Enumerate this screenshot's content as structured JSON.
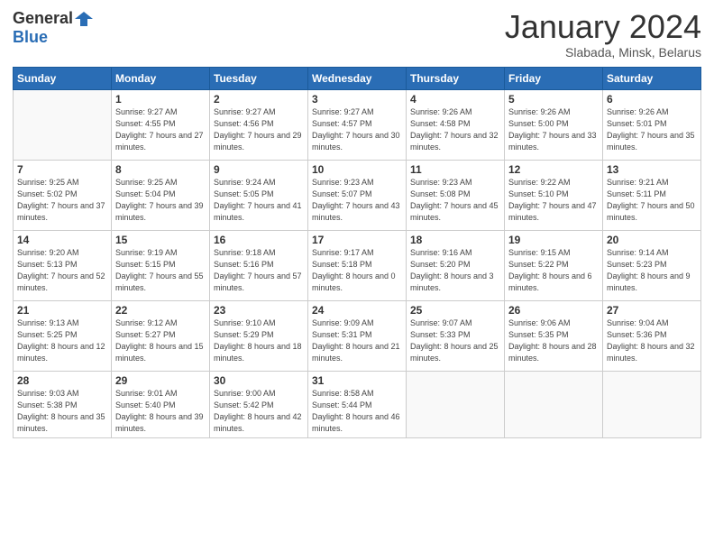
{
  "logo": {
    "general": "General",
    "blue": "Blue"
  },
  "header": {
    "title": "January 2024",
    "subtitle": "Slabada, Minsk, Belarus"
  },
  "weekdays": [
    "Sunday",
    "Monday",
    "Tuesday",
    "Wednesday",
    "Thursday",
    "Friday",
    "Saturday"
  ],
  "weeks": [
    [
      {
        "day": "",
        "sunrise": "",
        "sunset": "",
        "daylight": ""
      },
      {
        "day": "1",
        "sunrise": "Sunrise: 9:27 AM",
        "sunset": "Sunset: 4:55 PM",
        "daylight": "Daylight: 7 hours and 27 minutes."
      },
      {
        "day": "2",
        "sunrise": "Sunrise: 9:27 AM",
        "sunset": "Sunset: 4:56 PM",
        "daylight": "Daylight: 7 hours and 29 minutes."
      },
      {
        "day": "3",
        "sunrise": "Sunrise: 9:27 AM",
        "sunset": "Sunset: 4:57 PM",
        "daylight": "Daylight: 7 hours and 30 minutes."
      },
      {
        "day": "4",
        "sunrise": "Sunrise: 9:26 AM",
        "sunset": "Sunset: 4:58 PM",
        "daylight": "Daylight: 7 hours and 32 minutes."
      },
      {
        "day": "5",
        "sunrise": "Sunrise: 9:26 AM",
        "sunset": "Sunset: 5:00 PM",
        "daylight": "Daylight: 7 hours and 33 minutes."
      },
      {
        "day": "6",
        "sunrise": "Sunrise: 9:26 AM",
        "sunset": "Sunset: 5:01 PM",
        "daylight": "Daylight: 7 hours and 35 minutes."
      }
    ],
    [
      {
        "day": "7",
        "sunrise": "Sunrise: 9:25 AM",
        "sunset": "Sunset: 5:02 PM",
        "daylight": "Daylight: 7 hours and 37 minutes."
      },
      {
        "day": "8",
        "sunrise": "Sunrise: 9:25 AM",
        "sunset": "Sunset: 5:04 PM",
        "daylight": "Daylight: 7 hours and 39 minutes."
      },
      {
        "day": "9",
        "sunrise": "Sunrise: 9:24 AM",
        "sunset": "Sunset: 5:05 PM",
        "daylight": "Daylight: 7 hours and 41 minutes."
      },
      {
        "day": "10",
        "sunrise": "Sunrise: 9:23 AM",
        "sunset": "Sunset: 5:07 PM",
        "daylight": "Daylight: 7 hours and 43 minutes."
      },
      {
        "day": "11",
        "sunrise": "Sunrise: 9:23 AM",
        "sunset": "Sunset: 5:08 PM",
        "daylight": "Daylight: 7 hours and 45 minutes."
      },
      {
        "day": "12",
        "sunrise": "Sunrise: 9:22 AM",
        "sunset": "Sunset: 5:10 PM",
        "daylight": "Daylight: 7 hours and 47 minutes."
      },
      {
        "day": "13",
        "sunrise": "Sunrise: 9:21 AM",
        "sunset": "Sunset: 5:11 PM",
        "daylight": "Daylight: 7 hours and 50 minutes."
      }
    ],
    [
      {
        "day": "14",
        "sunrise": "Sunrise: 9:20 AM",
        "sunset": "Sunset: 5:13 PM",
        "daylight": "Daylight: 7 hours and 52 minutes."
      },
      {
        "day": "15",
        "sunrise": "Sunrise: 9:19 AM",
        "sunset": "Sunset: 5:15 PM",
        "daylight": "Daylight: 7 hours and 55 minutes."
      },
      {
        "day": "16",
        "sunrise": "Sunrise: 9:18 AM",
        "sunset": "Sunset: 5:16 PM",
        "daylight": "Daylight: 7 hours and 57 minutes."
      },
      {
        "day": "17",
        "sunrise": "Sunrise: 9:17 AM",
        "sunset": "Sunset: 5:18 PM",
        "daylight": "Daylight: 8 hours and 0 minutes."
      },
      {
        "day": "18",
        "sunrise": "Sunrise: 9:16 AM",
        "sunset": "Sunset: 5:20 PM",
        "daylight": "Daylight: 8 hours and 3 minutes."
      },
      {
        "day": "19",
        "sunrise": "Sunrise: 9:15 AM",
        "sunset": "Sunset: 5:22 PM",
        "daylight": "Daylight: 8 hours and 6 minutes."
      },
      {
        "day": "20",
        "sunrise": "Sunrise: 9:14 AM",
        "sunset": "Sunset: 5:23 PM",
        "daylight": "Daylight: 8 hours and 9 minutes."
      }
    ],
    [
      {
        "day": "21",
        "sunrise": "Sunrise: 9:13 AM",
        "sunset": "Sunset: 5:25 PM",
        "daylight": "Daylight: 8 hours and 12 minutes."
      },
      {
        "day": "22",
        "sunrise": "Sunrise: 9:12 AM",
        "sunset": "Sunset: 5:27 PM",
        "daylight": "Daylight: 8 hours and 15 minutes."
      },
      {
        "day": "23",
        "sunrise": "Sunrise: 9:10 AM",
        "sunset": "Sunset: 5:29 PM",
        "daylight": "Daylight: 8 hours and 18 minutes."
      },
      {
        "day": "24",
        "sunrise": "Sunrise: 9:09 AM",
        "sunset": "Sunset: 5:31 PM",
        "daylight": "Daylight: 8 hours and 21 minutes."
      },
      {
        "day": "25",
        "sunrise": "Sunrise: 9:07 AM",
        "sunset": "Sunset: 5:33 PM",
        "daylight": "Daylight: 8 hours and 25 minutes."
      },
      {
        "day": "26",
        "sunrise": "Sunrise: 9:06 AM",
        "sunset": "Sunset: 5:35 PM",
        "daylight": "Daylight: 8 hours and 28 minutes."
      },
      {
        "day": "27",
        "sunrise": "Sunrise: 9:04 AM",
        "sunset": "Sunset: 5:36 PM",
        "daylight": "Daylight: 8 hours and 32 minutes."
      }
    ],
    [
      {
        "day": "28",
        "sunrise": "Sunrise: 9:03 AM",
        "sunset": "Sunset: 5:38 PM",
        "daylight": "Daylight: 8 hours and 35 minutes."
      },
      {
        "day": "29",
        "sunrise": "Sunrise: 9:01 AM",
        "sunset": "Sunset: 5:40 PM",
        "daylight": "Daylight: 8 hours and 39 minutes."
      },
      {
        "day": "30",
        "sunrise": "Sunrise: 9:00 AM",
        "sunset": "Sunset: 5:42 PM",
        "daylight": "Daylight: 8 hours and 42 minutes."
      },
      {
        "day": "31",
        "sunrise": "Sunrise: 8:58 AM",
        "sunset": "Sunset: 5:44 PM",
        "daylight": "Daylight: 8 hours and 46 minutes."
      },
      {
        "day": "",
        "sunrise": "",
        "sunset": "",
        "daylight": ""
      },
      {
        "day": "",
        "sunrise": "",
        "sunset": "",
        "daylight": ""
      },
      {
        "day": "",
        "sunrise": "",
        "sunset": "",
        "daylight": ""
      }
    ]
  ]
}
